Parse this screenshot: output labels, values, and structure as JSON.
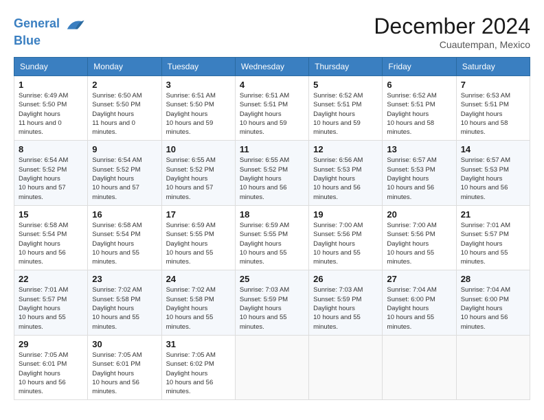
{
  "header": {
    "logo_line1": "General",
    "logo_line2": "Blue",
    "month_title": "December 2024",
    "location": "Cuautempan, Mexico"
  },
  "days_of_week": [
    "Sunday",
    "Monday",
    "Tuesday",
    "Wednesday",
    "Thursday",
    "Friday",
    "Saturday"
  ],
  "weeks": [
    [
      {
        "day": "1",
        "sunrise": "6:49 AM",
        "sunset": "5:50 PM",
        "daylight": "11 hours and 0 minutes."
      },
      {
        "day": "2",
        "sunrise": "6:50 AM",
        "sunset": "5:50 PM",
        "daylight": "11 hours and 0 minutes."
      },
      {
        "day": "3",
        "sunrise": "6:51 AM",
        "sunset": "5:50 PM",
        "daylight": "10 hours and 59 minutes."
      },
      {
        "day": "4",
        "sunrise": "6:51 AM",
        "sunset": "5:51 PM",
        "daylight": "10 hours and 59 minutes."
      },
      {
        "day": "5",
        "sunrise": "6:52 AM",
        "sunset": "5:51 PM",
        "daylight": "10 hours and 59 minutes."
      },
      {
        "day": "6",
        "sunrise": "6:52 AM",
        "sunset": "5:51 PM",
        "daylight": "10 hours and 58 minutes."
      },
      {
        "day": "7",
        "sunrise": "6:53 AM",
        "sunset": "5:51 PM",
        "daylight": "10 hours and 58 minutes."
      }
    ],
    [
      {
        "day": "8",
        "sunrise": "6:54 AM",
        "sunset": "5:52 PM",
        "daylight": "10 hours and 57 minutes."
      },
      {
        "day": "9",
        "sunrise": "6:54 AM",
        "sunset": "5:52 PM",
        "daylight": "10 hours and 57 minutes."
      },
      {
        "day": "10",
        "sunrise": "6:55 AM",
        "sunset": "5:52 PM",
        "daylight": "10 hours and 57 minutes."
      },
      {
        "day": "11",
        "sunrise": "6:55 AM",
        "sunset": "5:52 PM",
        "daylight": "10 hours and 56 minutes."
      },
      {
        "day": "12",
        "sunrise": "6:56 AM",
        "sunset": "5:53 PM",
        "daylight": "10 hours and 56 minutes."
      },
      {
        "day": "13",
        "sunrise": "6:57 AM",
        "sunset": "5:53 PM",
        "daylight": "10 hours and 56 minutes."
      },
      {
        "day": "14",
        "sunrise": "6:57 AM",
        "sunset": "5:53 PM",
        "daylight": "10 hours and 56 minutes."
      }
    ],
    [
      {
        "day": "15",
        "sunrise": "6:58 AM",
        "sunset": "5:54 PM",
        "daylight": "10 hours and 56 minutes."
      },
      {
        "day": "16",
        "sunrise": "6:58 AM",
        "sunset": "5:54 PM",
        "daylight": "10 hours and 55 minutes."
      },
      {
        "day": "17",
        "sunrise": "6:59 AM",
        "sunset": "5:55 PM",
        "daylight": "10 hours and 55 minutes."
      },
      {
        "day": "18",
        "sunrise": "6:59 AM",
        "sunset": "5:55 PM",
        "daylight": "10 hours and 55 minutes."
      },
      {
        "day": "19",
        "sunrise": "7:00 AM",
        "sunset": "5:56 PM",
        "daylight": "10 hours and 55 minutes."
      },
      {
        "day": "20",
        "sunrise": "7:00 AM",
        "sunset": "5:56 PM",
        "daylight": "10 hours and 55 minutes."
      },
      {
        "day": "21",
        "sunrise": "7:01 AM",
        "sunset": "5:57 PM",
        "daylight": "10 hours and 55 minutes."
      }
    ],
    [
      {
        "day": "22",
        "sunrise": "7:01 AM",
        "sunset": "5:57 PM",
        "daylight": "10 hours and 55 minutes."
      },
      {
        "day": "23",
        "sunrise": "7:02 AM",
        "sunset": "5:58 PM",
        "daylight": "10 hours and 55 minutes."
      },
      {
        "day": "24",
        "sunrise": "7:02 AM",
        "sunset": "5:58 PM",
        "daylight": "10 hours and 55 minutes."
      },
      {
        "day": "25",
        "sunrise": "7:03 AM",
        "sunset": "5:59 PM",
        "daylight": "10 hours and 55 minutes."
      },
      {
        "day": "26",
        "sunrise": "7:03 AM",
        "sunset": "5:59 PM",
        "daylight": "10 hours and 55 minutes."
      },
      {
        "day": "27",
        "sunrise": "7:04 AM",
        "sunset": "6:00 PM",
        "daylight": "10 hours and 55 minutes."
      },
      {
        "day": "28",
        "sunrise": "7:04 AM",
        "sunset": "6:00 PM",
        "daylight": "10 hours and 56 minutes."
      }
    ],
    [
      {
        "day": "29",
        "sunrise": "7:05 AM",
        "sunset": "6:01 PM",
        "daylight": "10 hours and 56 minutes."
      },
      {
        "day": "30",
        "sunrise": "7:05 AM",
        "sunset": "6:01 PM",
        "daylight": "10 hours and 56 minutes."
      },
      {
        "day": "31",
        "sunrise": "7:05 AM",
        "sunset": "6:02 PM",
        "daylight": "10 hours and 56 minutes."
      },
      null,
      null,
      null,
      null
    ]
  ]
}
